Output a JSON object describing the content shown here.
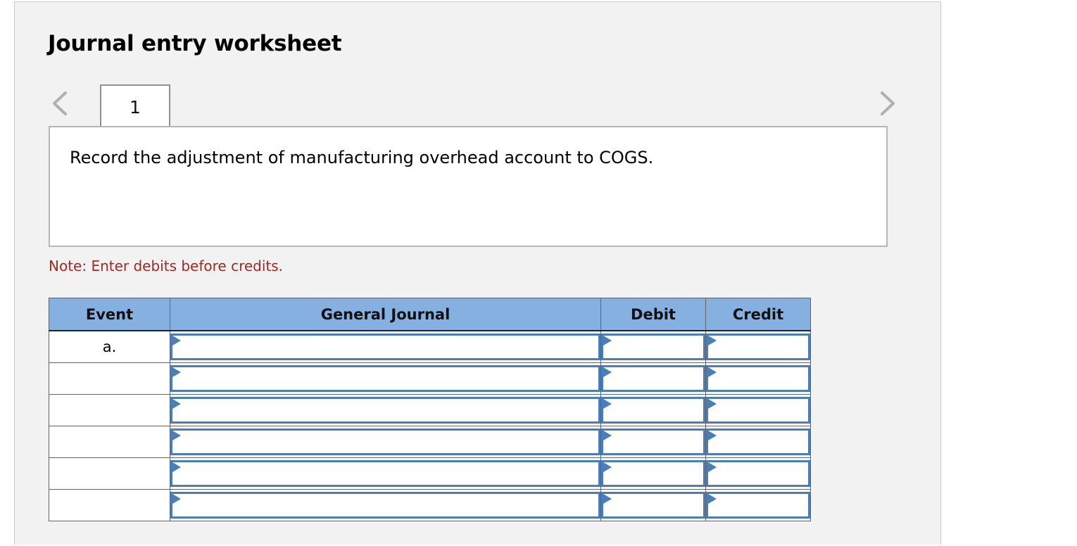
{
  "page": {
    "title": "Journal entry worksheet"
  },
  "tabs": {
    "prev_icon": "chevron-left-icon",
    "next_icon": "chevron-right-icon",
    "items": [
      {
        "label": "1",
        "active": true
      }
    ]
  },
  "instruction": {
    "text": "Record the adjustment of manufacturing overhead account to COGS."
  },
  "note": {
    "text": "Note: Enter debits before credits.",
    "color": "#a02a22"
  },
  "table": {
    "header_bg": "#86b0e0",
    "input_border": "#4a7ebb",
    "columns": [
      {
        "key": "event",
        "label": "Event"
      },
      {
        "key": "general_journal",
        "label": "General Journal"
      },
      {
        "key": "debit",
        "label": "Debit"
      },
      {
        "key": "credit",
        "label": "Credit"
      }
    ],
    "rows": [
      {
        "event": "a.",
        "general_journal": "",
        "debit": "",
        "credit": ""
      },
      {
        "event": "",
        "general_journal": "",
        "debit": "",
        "credit": ""
      },
      {
        "event": "",
        "general_journal": "",
        "debit": "",
        "credit": ""
      },
      {
        "event": "",
        "general_journal": "",
        "debit": "",
        "credit": ""
      },
      {
        "event": "",
        "general_journal": "",
        "debit": "",
        "credit": ""
      },
      {
        "event": "",
        "general_journal": "",
        "debit": "",
        "credit": ""
      }
    ]
  }
}
